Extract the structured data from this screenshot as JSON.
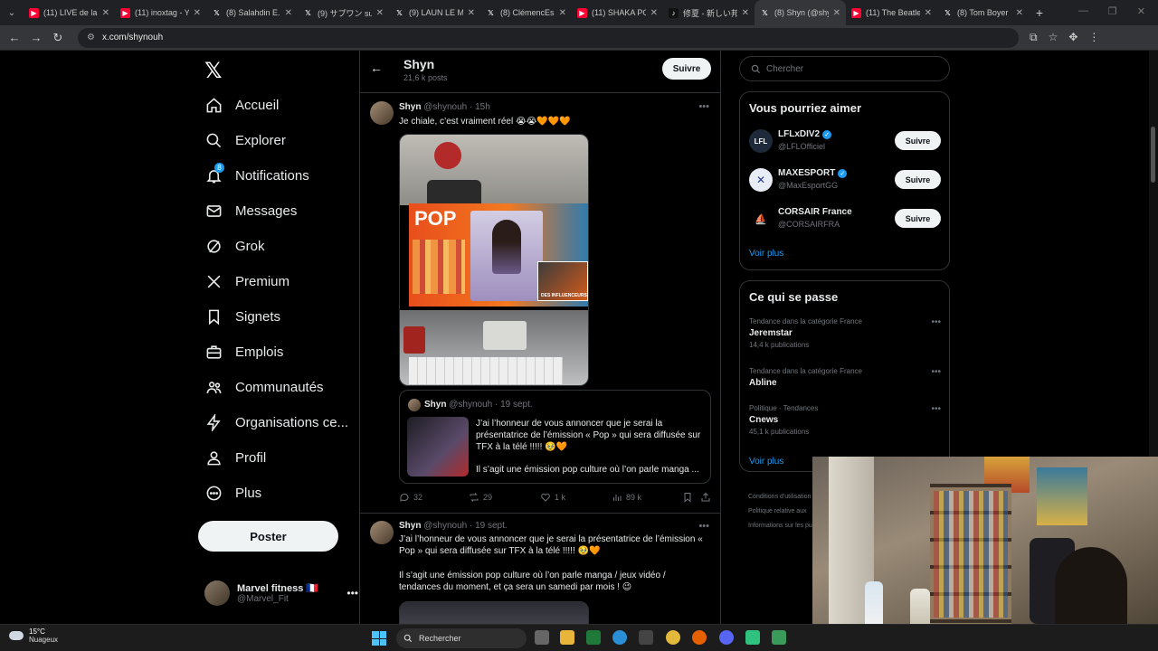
{
  "browser": {
    "tabs": [
      {
        "label": "(11) LIVE de la",
        "icon": "youtube-icon"
      },
      {
        "label": "(11) inoxtag - Y",
        "icon": "youtube-icon"
      },
      {
        "label": "(8) Salahdin E.",
        "icon": "x-icon"
      },
      {
        "label": "(9) サプワン sur",
        "icon": "x-icon"
      },
      {
        "label": "(9) LAUN LE M",
        "icon": "x-icon"
      },
      {
        "label": "(8) ClémencEsp",
        "icon": "x-icon"
      },
      {
        "label": "(11) SHAKA PO",
        "icon": "youtube-icon"
      },
      {
        "label": "修夏 - 新しい邦",
        "icon": "tiktok-icon"
      },
      {
        "label": "(8) Shyn (@shy",
        "icon": "x-icon"
      },
      {
        "label": "(11) The Beatle",
        "icon": "youtube-icon"
      },
      {
        "label": "(8) Tom Boyer",
        "icon": "x-icon"
      }
    ],
    "active_tab_index": 8,
    "url": "x.com/shynouh"
  },
  "nav": {
    "items": [
      {
        "label": "Accueil",
        "icon": "home-icon"
      },
      {
        "label": "Explorer",
        "icon": "search-icon"
      },
      {
        "label": "Notifications",
        "icon": "bell-icon",
        "badge": "8"
      },
      {
        "label": "Messages",
        "icon": "envelope-icon"
      },
      {
        "label": "Grok",
        "icon": "grok-icon"
      },
      {
        "label": "Premium",
        "icon": "x-icon"
      },
      {
        "label": "Signets",
        "icon": "bookmark-icon"
      },
      {
        "label": "Emplois",
        "icon": "briefcase-icon"
      },
      {
        "label": "Communautés",
        "icon": "people-icon"
      },
      {
        "label": "Organisations ce...",
        "icon": "lightning-icon"
      },
      {
        "label": "Profil",
        "icon": "person-icon"
      },
      {
        "label": "Plus",
        "icon": "more-circle-icon"
      }
    ],
    "post_label": "Poster",
    "account": {
      "name": "Marvel fitness 🇫🇷",
      "handle": "@Marvel_Fit"
    }
  },
  "profile": {
    "name": "Shyn",
    "posts": "21,6 k posts",
    "follow_label": "Suivre"
  },
  "tweet1": {
    "name": "Shyn",
    "handle": "@shynouh",
    "time": "· 15h",
    "text": "Je chiale, c’est vraiment réel 😭😭🧡🧡🧡",
    "quote": {
      "name": "Shyn",
      "handle": "@shynouh",
      "time": "· 19 sept.",
      "text": "J’ai l’honneur de vous annoncer que je serai la présentatrice de l’émission « Pop » qui sera diffusée sur TFX à la télé !!!!! 🥹🧡",
      "text2": "Il s’agit une émission pop culture où l’on parle manga ..."
    },
    "stats": {
      "replies": "32",
      "reposts": "29",
      "likes": "1 k",
      "views": "89 k"
    },
    "media": {
      "pop_text": "POP",
      "inset_text": "DES INFLUENCEURS"
    }
  },
  "tweet2": {
    "name": "Shyn",
    "handle": "@shynouh",
    "time": "· 19 sept.",
    "text": "J’ai l’honneur de vous annoncer que je serai la présentatrice de l’émission « Pop » qui sera diffusée sur TFX à la télé !!!!! 🥹🧡",
    "text2": "Il s’agit une émission pop culture où l’on parle manga / jeux vidéo / tendances du moment, et ça sera un samedi par mois ! 😉"
  },
  "right": {
    "search_placeholder": "Chercher",
    "suggest_title": "Vous pourriez aimer",
    "suggestions": [
      {
        "name": "LFLxDIV2",
        "handle": "@LFLOfficiel",
        "avatar_text": "LFL",
        "follow": "Suivre"
      },
      {
        "name": "MAXESPORT",
        "handle": "@MaxEsportGG",
        "avatar_text": "✕",
        "follow": "Suivre"
      },
      {
        "name": "CORSAIR France",
        "handle": "@CORSAIRFRA",
        "avatar_text": "⛵",
        "follow": "Suivre"
      }
    ],
    "see_more": "Voir plus",
    "trends_title": "Ce qui se passe",
    "trends": [
      {
        "category": "Tendance dans la catégorie France",
        "name": "Jeremstar",
        "count": "14,4 k publications"
      },
      {
        "category": "Tendance dans la catégorie France",
        "name": "Abline",
        "count": ""
      },
      {
        "category": "Politique · Tendances",
        "name": "Cnews",
        "count": "45,1 k publications"
      }
    ],
    "see_more2": "Voir plus",
    "footer": [
      "Conditions d'utilisation",
      "Politique relative aux",
      "Informations sur les pu"
    ]
  },
  "taskbar": {
    "temp": "15°C",
    "weather": "Nuageux",
    "search_label": "Rechercher"
  }
}
